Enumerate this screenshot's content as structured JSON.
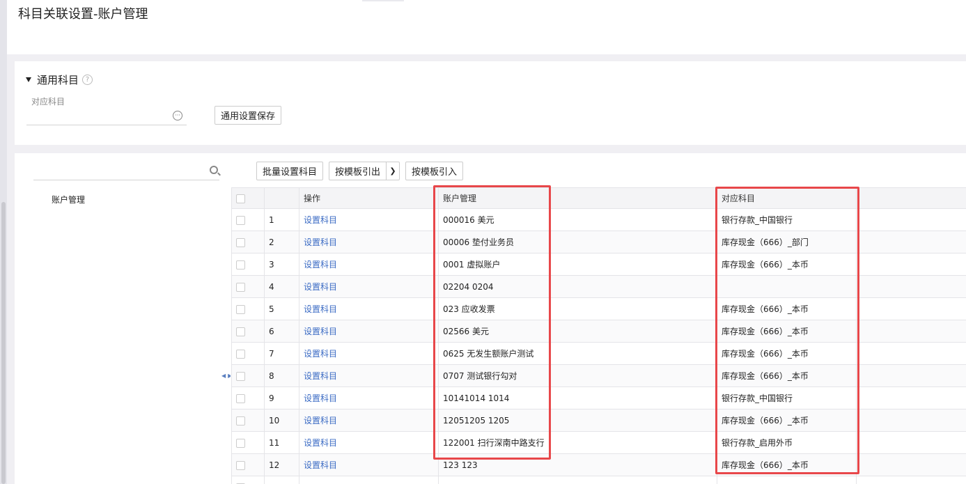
{
  "page": {
    "title": "科目关联设置-账户管理"
  },
  "common_section": {
    "title": "通用科目",
    "help_icon": "question-circle-icon",
    "field_label": "对应科目",
    "field_value": "",
    "more_icon": "ellipsis-icon",
    "save_button": "通用设置保存"
  },
  "tree": {
    "search_placeholder": "",
    "search_icon": "search-icon",
    "items": [
      {
        "label": "账户管理"
      }
    ]
  },
  "toolbar": {
    "batch_set": "批量设置科目",
    "export_template": "按模板引出",
    "export_arrow_icon": "chevron-down-icon",
    "import_template": "按模板引入"
  },
  "grid": {
    "headers": {
      "op": "操作",
      "account": "账户管理",
      "subject": "对应科目"
    },
    "rows": [
      {
        "no": "1",
        "op": "设置科目",
        "account": "000016  美元",
        "subject": "银行存款_中国银行"
      },
      {
        "no": "2",
        "op": "设置科目",
        "account": "00006  垫付业务员",
        "subject": "库存现金（666）_部门"
      },
      {
        "no": "3",
        "op": "设置科目",
        "account": "0001  虚拟账户",
        "subject": "库存现金（666）_本币"
      },
      {
        "no": "4",
        "op": "设置科目",
        "account": "02204  0204",
        "subject": ""
      },
      {
        "no": "5",
        "op": "设置科目",
        "account": "023  应收发票",
        "subject": "库存现金（666）_本币"
      },
      {
        "no": "6",
        "op": "设置科目",
        "account": "02566  美元",
        "subject": "库存现金（666）_本币"
      },
      {
        "no": "7",
        "op": "设置科目",
        "account": "0625  无发生额账户测试",
        "subject": "库存现金（666）_本币"
      },
      {
        "no": "8",
        "op": "设置科目",
        "account": "0707  测试银行勾对",
        "subject": "库存现金（666）_本币"
      },
      {
        "no": "9",
        "op": "设置科目",
        "account": "10141014  1014",
        "subject": "银行存款_中国银行"
      },
      {
        "no": "10",
        "op": "设置科目",
        "account": "12051205  1205",
        "subject": "库存现金（666）_本币"
      },
      {
        "no": "11",
        "op": "设置科目",
        "account": "122001  扫行深南中路支行",
        "subject": "银行存款_启用外币"
      },
      {
        "no": "12",
        "op": "设置科目",
        "account": "123  123",
        "subject": "库存现金（666）_本币"
      }
    ]
  },
  "highlight_color": "#e8474a"
}
